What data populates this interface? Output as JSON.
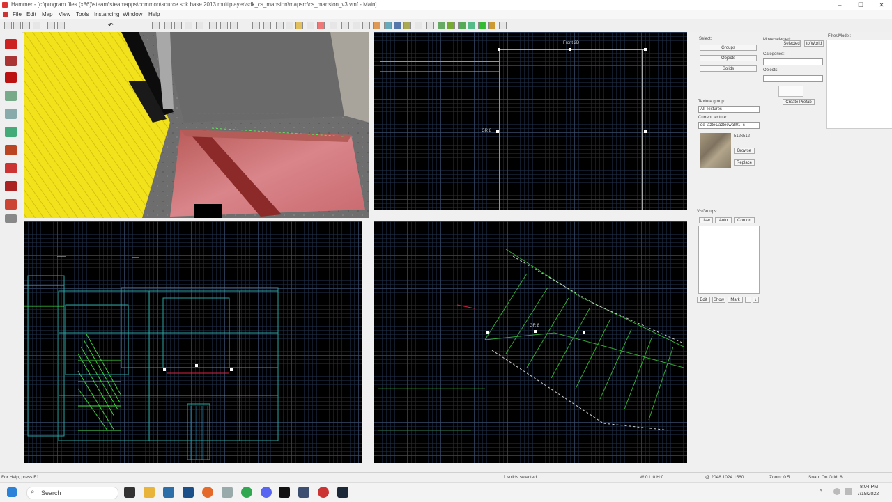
{
  "window": {
    "title": "Hammer - [c:\\program files (x86)\\steam\\steamapps\\common\\source sdk base 2013 multiplayer\\sdk_cs_mansion\\mapsrc\\cs_mansion_v3.vmf - Main]",
    "minimize": "–",
    "maximize": "☐",
    "close": "✕"
  },
  "menu": [
    "File",
    "Edit",
    "Map",
    "View",
    "Tools",
    "Instancing",
    "Window",
    "Help"
  ],
  "viewports": {
    "top_right_label": "Front 2D",
    "top_right_mark": "GR 8",
    "bottom_right_mark": "GR 8"
  },
  "panel": {
    "select_label": "Select:",
    "groups": "Groups",
    "objects": "Objects",
    "solids": "Solids",
    "move_label": "Move selected:",
    "move_btn": "Selected",
    "to_world": "to World",
    "categories_label": "Categories:",
    "objects_label": "Objects:",
    "create_prefab": "Create Prefab",
    "texture_group_label": "Texture group:",
    "texture_group_value": "All Textures",
    "current_texture_label": "Current texture:",
    "current_texture_value": "de_aztec/aztecwall01_c",
    "texture_size": "512x512",
    "browse": "Browse",
    "replace": "Replace",
    "visgroups_label": "VisGroups:",
    "tab_user": "User",
    "tab_auto": "Auto",
    "tab_cordon": "Cordon",
    "edit": "Edit",
    "mark": "Mark",
    "show": "Show",
    "up": "↑",
    "down": "↓",
    "filter_label": "Filter/Model:"
  },
  "status": {
    "help": "For Help, press F1",
    "selection": "1 solids selected",
    "size": "W:0  L:0  H:0",
    "coords": "@ 2048 1024 1560",
    "zoom": "Zoom: 0.5",
    "snap": "Snap: On Grid: 8"
  },
  "taskbar": {
    "search_placeholder": "Search",
    "time": "8:04 PM",
    "date": "7/19/2022"
  }
}
